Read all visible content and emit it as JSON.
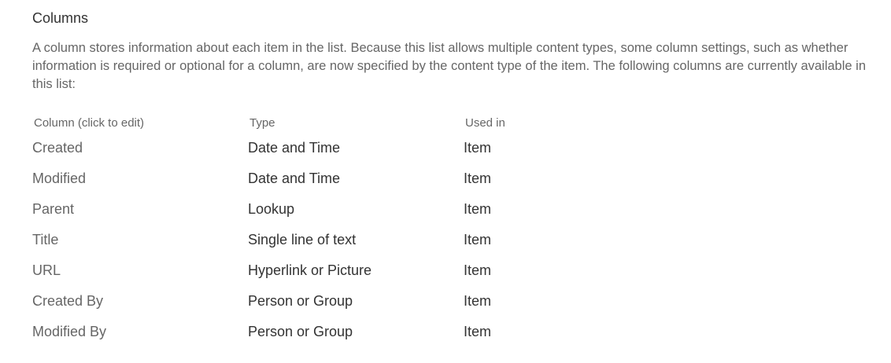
{
  "section": {
    "title": "Columns",
    "description": "A column stores information about each item in the list. Because this list allows multiple content types, some column settings, such as whether information is required or optional for a column, are now specified by the content type of the item. The following columns are currently available in this list:"
  },
  "table": {
    "headers": {
      "column": "Column (click to edit)",
      "type": "Type",
      "used_in": "Used in"
    },
    "rows": [
      {
        "column": "Created",
        "type": "Date and Time",
        "used_in": "Item"
      },
      {
        "column": "Modified",
        "type": "Date and Time",
        "used_in": "Item"
      },
      {
        "column": "Parent",
        "type": "Lookup",
        "used_in": "Item"
      },
      {
        "column": "Title",
        "type": "Single line of text",
        "used_in": "Item"
      },
      {
        "column": "URL",
        "type": "Hyperlink or Picture",
        "used_in": "Item"
      },
      {
        "column": "Created By",
        "type": "Person or Group",
        "used_in": "Item"
      },
      {
        "column": "Modified By",
        "type": "Person or Group",
        "used_in": "Item"
      }
    ]
  }
}
